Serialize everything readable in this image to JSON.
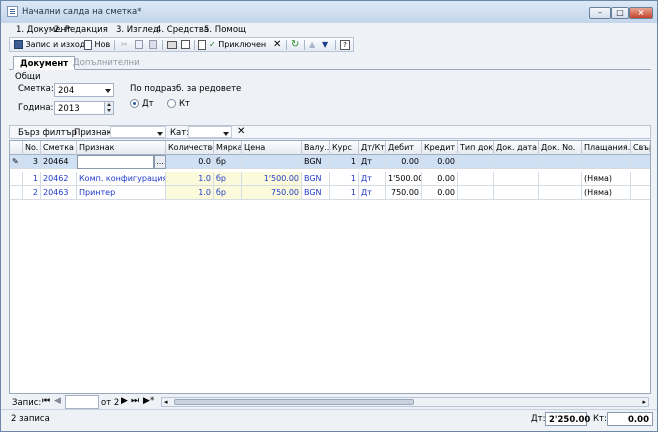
{
  "window": {
    "title": "Начални салда на сметка*"
  },
  "menu": [
    "1. Документ",
    "2. Редакция",
    "3. Изглед",
    "4. Средства",
    "5. Помощ"
  ],
  "toolbar": {
    "save_exit": "Запис и изход",
    "new": "Нов",
    "complete": "Приключен"
  },
  "tabs": {
    "document": "Документ",
    "additional": "Допълнителни"
  },
  "general": {
    "group": "Общи",
    "account_label": "Сметка:",
    "account_value": "204",
    "year_label": "Година:",
    "year_value": "2013",
    "split_label": "По подразб. за редовете",
    "debit_radio": "Дт",
    "credit_radio": "Кт"
  },
  "filter": {
    "quick": "Бърз филтър",
    "attribute": "Признак:",
    "category": "Кат:"
  },
  "table": {
    "columns": [
      "No.",
      "Сметка",
      "Признак",
      "Количество",
      "Мярка",
      "Цена",
      "Валу...",
      "Курс",
      "Дт/Кт",
      "Дебит",
      "Кредит",
      "Тип док.",
      "Док. дата",
      "Док. No.",
      "Плащания...",
      "Свър"
    ],
    "edit_row": {
      "no": "3",
      "account": "20464",
      "attr": "",
      "btn": "...",
      "qty": "0.0",
      "unit": "бр",
      "price": "",
      "curr": "BGN",
      "rate": "1",
      "dk": "Дт",
      "debit": "0.00",
      "credit": "0.00",
      "pay": ""
    },
    "rows": [
      {
        "no": "1",
        "account": "20462",
        "attr": "Комп. конфигурация",
        "qty": "1.0",
        "unit": "бр",
        "price": "1'500.00",
        "curr": "BGN",
        "rate": "1",
        "dk": "Дт",
        "debit": "1'500.00",
        "credit": "0.00",
        "pay": "(Няма)"
      },
      {
        "no": "2",
        "account": "20463",
        "attr": "Принтер",
        "qty": "1.0",
        "unit": "бр",
        "price": "750.00",
        "curr": "BGN",
        "rate": "1",
        "dk": "Дт",
        "debit": "750.00",
        "credit": "0.00",
        "pay": "(Няма)"
      }
    ]
  },
  "nav": {
    "record_label": "Запис:",
    "of": "от 2"
  },
  "status": {
    "records": "2 записа",
    "debit_label": "Дт:",
    "debit_total": "2'250.00",
    "credit_label": "Кт:",
    "credit_total": "0.00"
  }
}
